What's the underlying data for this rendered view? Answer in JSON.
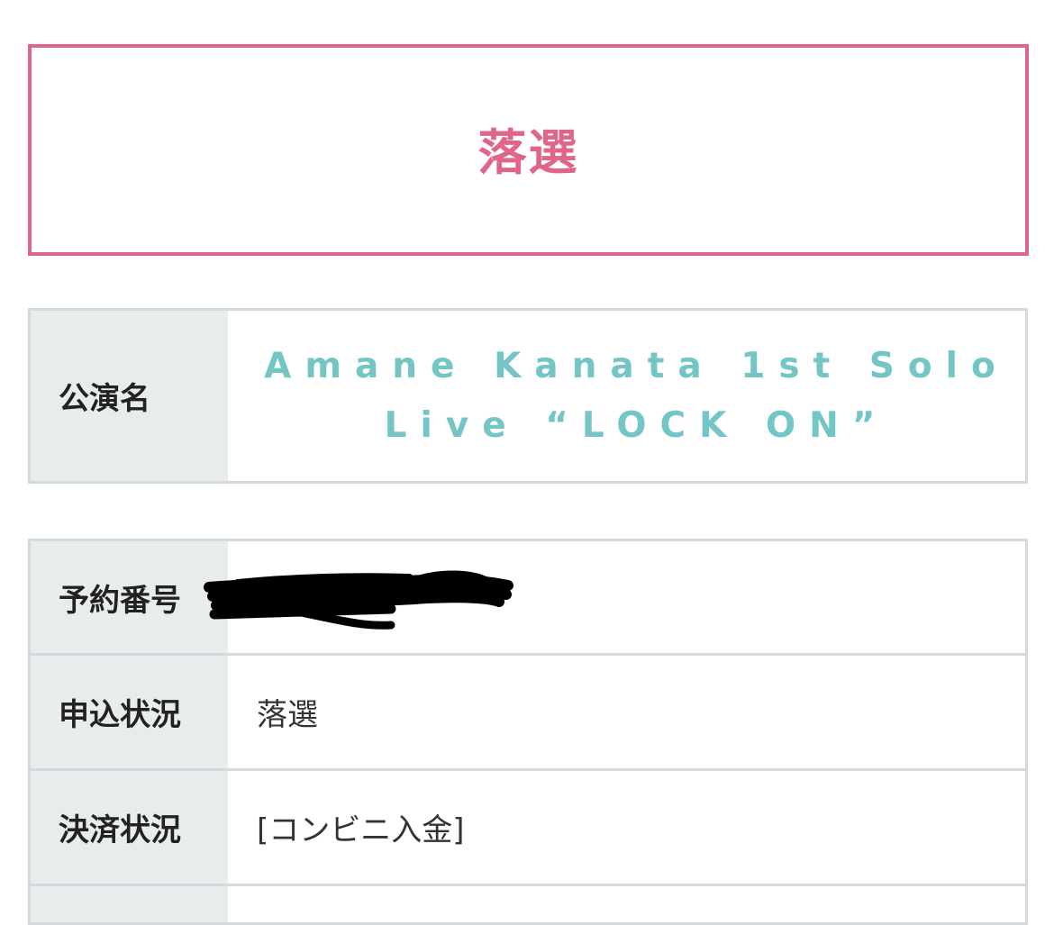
{
  "status_banner": {
    "label": "落選",
    "color": "#e06689"
  },
  "event": {
    "header": "公演名",
    "title": "Amane Kanata 1st Solo\nLive “LOCK ON”",
    "title_color": "#74c5c6"
  },
  "details": {
    "rows": [
      {
        "label": "予約番号",
        "value": ""
      },
      {
        "label": "申込状況",
        "value": "落選"
      },
      {
        "label": "決済状況",
        "value": "[コンビニ入金]"
      }
    ]
  }
}
